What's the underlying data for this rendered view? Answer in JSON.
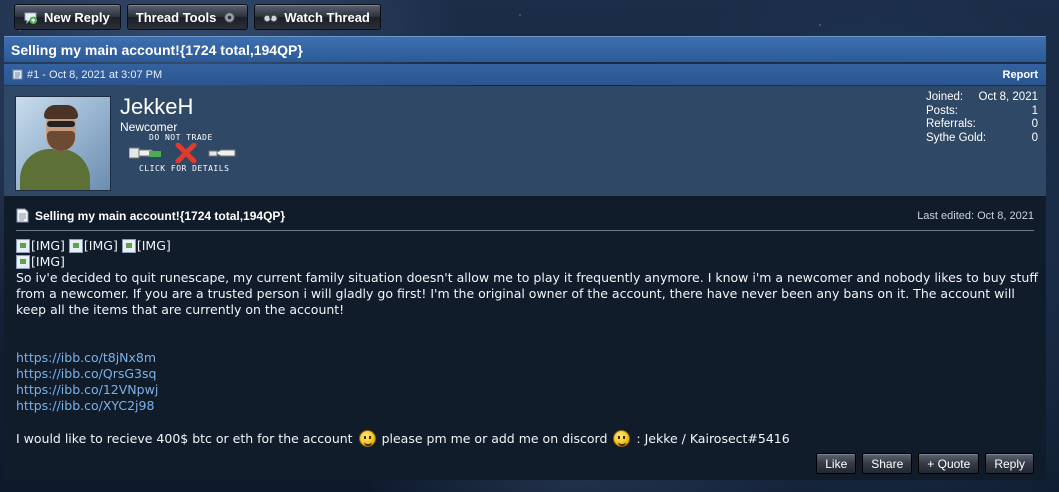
{
  "toolbar": {
    "new_reply": "New Reply",
    "thread_tools": "Thread Tools",
    "watch_thread": "Watch Thread"
  },
  "thread": {
    "title": "Selling my main account!{1724 total,194QP}"
  },
  "post": {
    "meta": "#1 - Oct 8, 2021 at 3:07 PM",
    "report": "Report",
    "title": "Selling my main account!{1724 total,194QP}",
    "edited": "Last edited: Oct 8, 2021",
    "images": [
      "[IMG]",
      "[IMG]",
      "[IMG]",
      "[IMG]"
    ],
    "paragraph": "So iv'e decided to quit runescape, my current family situation doesn't allow me to play it frequently anymore. I know i'm a newcomer and nobody likes to buy stuff from a newcomer. If you are a trusted person i will gladly go first! I'm the original owner of the account, there have never been any bans on it. The account will keep all the items that are currently on the account!",
    "links": [
      "https://ibb.co/t8jNx8m",
      "https://ibb.co/QrsG3sq",
      "https://ibb.co/12VNpwj",
      "https://ibb.co/XYC2j98"
    ],
    "final_part1": "I would like to recieve 400$ btc or eth for the account",
    "final_part2": "please pm me or add me on discord",
    "final_part3": ": Jekke / Kairosect#5416"
  },
  "user": {
    "name": "JekkeH",
    "title": "Newcomer",
    "badge_top": "DO NOT TRADE",
    "badge_bottom": "CLICK FOR DETAILS",
    "stats": [
      {
        "label": "Joined:",
        "value": "Oct 8, 2021"
      },
      {
        "label": "Posts:",
        "value": "1"
      },
      {
        "label": "Referrals:",
        "value": "0"
      },
      {
        "label": "Sythe Gold:",
        "value": "0"
      }
    ]
  },
  "actions": {
    "like": "Like",
    "share": "Share",
    "quote": "+ Quote",
    "reply": "Reply"
  },
  "colors": {
    "title_bar": "#2b5a98",
    "user_panel": "#2f4866",
    "post_body": "#111c2b",
    "link": "#7bb0e8"
  }
}
